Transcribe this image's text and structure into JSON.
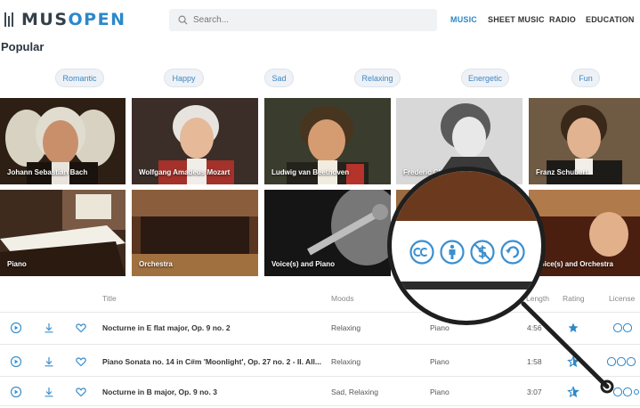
{
  "brand": {
    "logo_text_dark": "MUS",
    "logo_text_blue": "OPEN"
  },
  "search": {
    "placeholder": "Search..."
  },
  "nav": [
    {
      "label": "MUSIC",
      "active": true
    },
    {
      "label": "SHEET MUSIC",
      "active": false
    },
    {
      "label": "RADIO",
      "active": false
    },
    {
      "label": "EDUCATION",
      "active": false
    }
  ],
  "section_title": "Popular",
  "moods": [
    "Romantic",
    "Happy",
    "Sad",
    "Relaxing",
    "Energetic",
    "Fun"
  ],
  "composers": [
    "Johann Sebastian Bach",
    "Wolfgang Amadeus Mozart",
    "Ludwig van Beethoven",
    "Frederic Chopin",
    "Franz Schubert"
  ],
  "instruments": [
    "Piano",
    "Orchestra",
    "Voice(s) and Piano",
    "",
    "Voice(s) and Orchestra"
  ],
  "table": {
    "headers": {
      "title": "Title",
      "moods": "Moods",
      "length": "Length",
      "rating": "Rating",
      "license": "License"
    },
    "rows": [
      {
        "title": "Nocturne in E flat major, Op. 9 no. 2",
        "moods": "Relaxing",
        "instrument": "Piano",
        "length": "4:56"
      },
      {
        "title": "Piano Sonata no. 14 in C#m 'Moonlight', Op. 27 no. 2 - II. All...",
        "moods": "Relaxing",
        "instrument": "Piano",
        "length": "1:58"
      },
      {
        "title": "Nocturne in B major, Op. 9 no. 3",
        "moods": "Sad, Relaxing",
        "instrument": "Piano",
        "length": "3:07"
      }
    ]
  },
  "magnifier": {
    "icons": [
      "cc-icon",
      "attribution-icon",
      "noncommercial-icon",
      "sharealike-icon"
    ]
  },
  "colors": {
    "accent": "#2c88c9",
    "heading": "#2a3540"
  }
}
